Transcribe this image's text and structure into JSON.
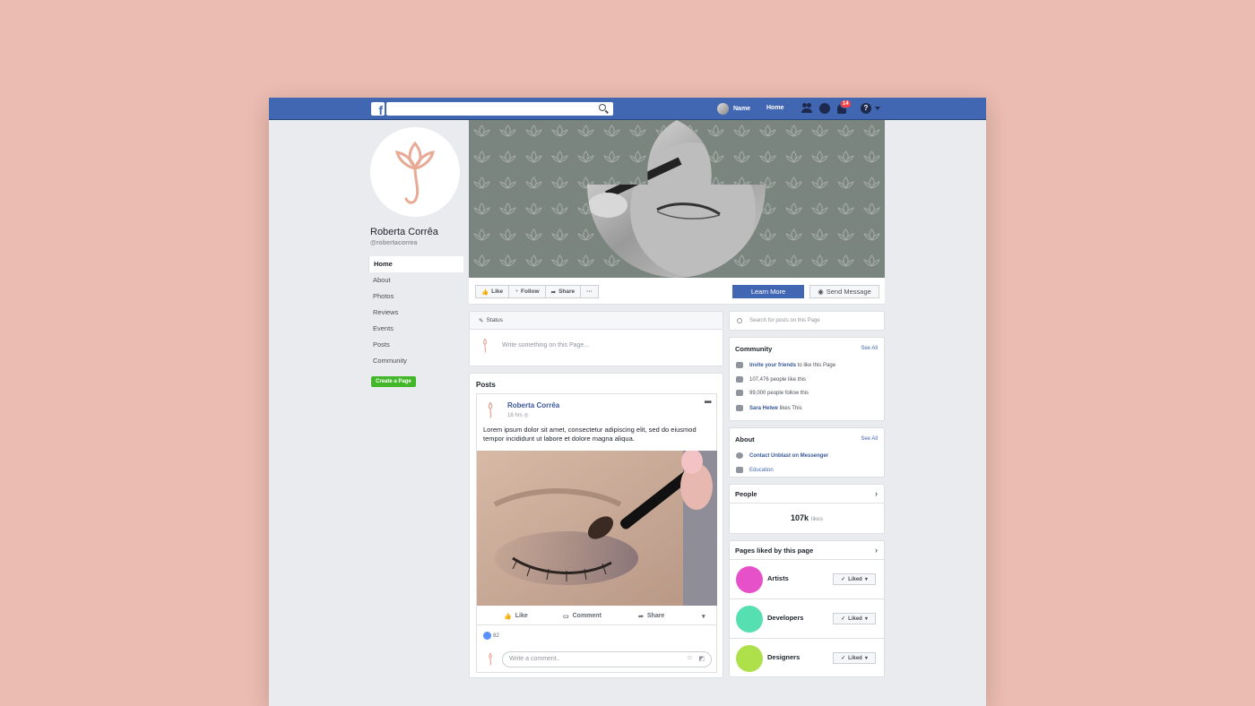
{
  "topbar": {
    "search_placeholder": "",
    "user_name": "Name",
    "home_label": "Home",
    "notification_count": "14",
    "brand_color": "#4267b2"
  },
  "profile": {
    "name": "Roberta Corrêa",
    "handle": "@robertacorrea"
  },
  "left_nav": {
    "items": [
      {
        "label": "Home"
      },
      {
        "label": "About"
      },
      {
        "label": "Photos"
      },
      {
        "label": "Reviews"
      },
      {
        "label": "Events"
      },
      {
        "label": "Posts"
      },
      {
        "label": "Community"
      }
    ],
    "create_page": "Create a Page"
  },
  "actions": {
    "like": "Like",
    "follow": "Follow",
    "share": "Share",
    "more": "···",
    "learn_more": "Learn More",
    "send_message": "Send Message"
  },
  "status": {
    "title": "Status",
    "placeholder": "Write something on this Page..."
  },
  "posts": {
    "title": "Posts",
    "post": {
      "author": "Roberta Corrêa",
      "time": "18 hrs",
      "text": "Lorem ipsum dolor sit amet, consectetur adipiscing elit, sed do eiusmod tempor incididunt ut labore et dolore magna aliqua.",
      "like": "Like",
      "comment": "Comment",
      "share": "Share",
      "likes": "82",
      "comment_placeholder": "Write a comment..",
      "more": "•••"
    }
  },
  "sidebar": {
    "search_placeholder": "Search for posts on this Page",
    "community": {
      "title": "Community",
      "see_all": "See All",
      "invite_link": "Invite your friends",
      "invite_rest": "to like this Page",
      "likes": "107,476 people like this",
      "follows": "99,000 people follow this",
      "friend_link": "Sara Helwe",
      "friend_rest": "likes This"
    },
    "about": {
      "title": "About",
      "see_all": "See All",
      "contact": "Contact Unblast on Messenger",
      "category": "Education"
    },
    "people": {
      "title": "People",
      "count": "107k",
      "unit": "likes"
    },
    "liked_pages": {
      "title": "Pages liked by this page",
      "liked_label": "Liked",
      "pages": [
        {
          "name": "Artists",
          "color": "#e651c9"
        },
        {
          "name": "Developers",
          "color": "#56dfb1"
        },
        {
          "name": "Designers",
          "color": "#aee04a"
        }
      ]
    }
  }
}
